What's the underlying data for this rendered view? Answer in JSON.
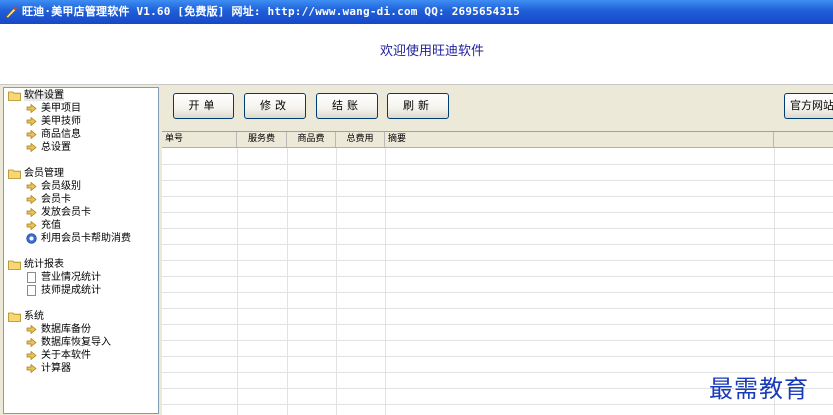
{
  "window": {
    "title": "旺迪·美甲店管理软件 V1.60 [免费版]   网址: http://www.wang-di.com   QQ: 2695654315"
  },
  "banner": {
    "welcome": "欢迎使用旺迪软件"
  },
  "sidebar": {
    "groups": [
      {
        "label": "软件设置",
        "icon": "folder-icon",
        "items": [
          {
            "label": "美甲项目",
            "icon": "arrow-icon"
          },
          {
            "label": "美甲技师",
            "icon": "arrow-icon"
          },
          {
            "label": "商品信息",
            "icon": "arrow-icon"
          },
          {
            "label": "总设置",
            "icon": "arrow-icon"
          }
        ]
      },
      {
        "label": "会员管理",
        "icon": "folder-icon",
        "items": [
          {
            "label": "会员级别",
            "icon": "arrow-icon"
          },
          {
            "label": "会员卡",
            "icon": "arrow-icon"
          },
          {
            "label": "发放会员卡",
            "icon": "arrow-icon"
          },
          {
            "label": "充值",
            "icon": "arrow-icon"
          },
          {
            "label": "利用会员卡帮助消费",
            "icon": "info-icon"
          }
        ]
      },
      {
        "label": "统计报表",
        "icon": "folder-icon",
        "items": [
          {
            "label": "营业情况统计",
            "icon": "document-icon"
          },
          {
            "label": "技师提成统计",
            "icon": "document-icon"
          }
        ]
      },
      {
        "label": "系统",
        "icon": "folder-icon",
        "items": [
          {
            "label": "数据库备份",
            "icon": "arrow-icon"
          },
          {
            "label": "数据库恢复导入",
            "icon": "arrow-icon"
          },
          {
            "label": "关于本软件",
            "icon": "arrow-icon"
          },
          {
            "label": "计算器",
            "icon": "arrow-icon"
          }
        ]
      }
    ]
  },
  "toolbar": {
    "open_label": "开单",
    "edit_label": "修改",
    "checkout_label": "结账",
    "refresh_label": "刷新",
    "website_label": "官方网站"
  },
  "grid": {
    "columns": [
      "单号",
      "服务费",
      "商品费",
      "总费用",
      "摘要"
    ],
    "rows": []
  },
  "watermark": "最需教育",
  "colors": {
    "title_bar": "#1f5fd8",
    "welcome_text": "#22229c",
    "watermark": "#1a3bb8"
  }
}
